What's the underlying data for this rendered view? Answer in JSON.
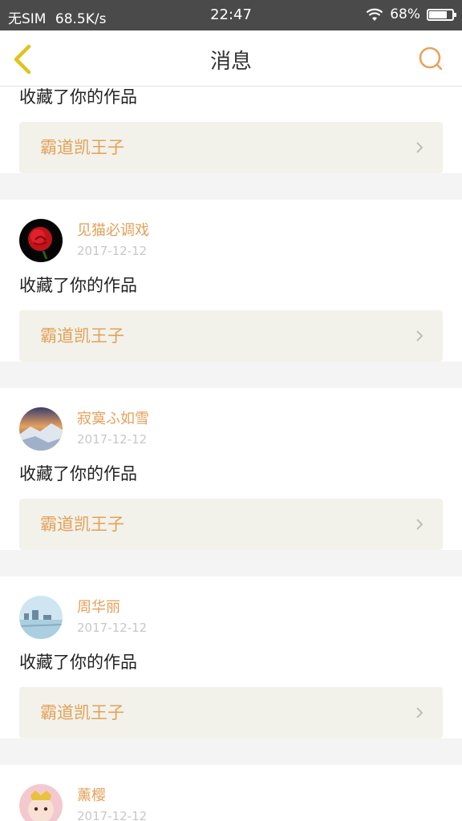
{
  "status_bar": {
    "carrier": "无SIM",
    "speed": "68.5K/s",
    "time": "22:47",
    "battery": "68%"
  },
  "nav": {
    "title": "消息",
    "back_icon": "chevron-left-icon",
    "search_icon": "search-icon"
  },
  "colors": {
    "accent": "#e3a15a",
    "back_icon": "#e0c31e",
    "work_bg": "#f2f2ea"
  },
  "messages": [
    {
      "action": "收藏了你的作品",
      "work": "霸道凯王子"
    },
    {
      "username": "见猫必调戏",
      "date": "2017-12-12",
      "action": "收藏了你的作品",
      "work": "霸道凯王子"
    },
    {
      "username": "寂寞ふ如雪",
      "date": "2017-12-12",
      "action": "收藏了你的作品",
      "work": "霸道凯王子"
    },
    {
      "username": "周华丽",
      "date": "2017-12-12",
      "action": "收藏了你的作品",
      "work": "霸道凯王子"
    },
    {
      "username": "薰樱",
      "date": "2017-12-12"
    }
  ]
}
